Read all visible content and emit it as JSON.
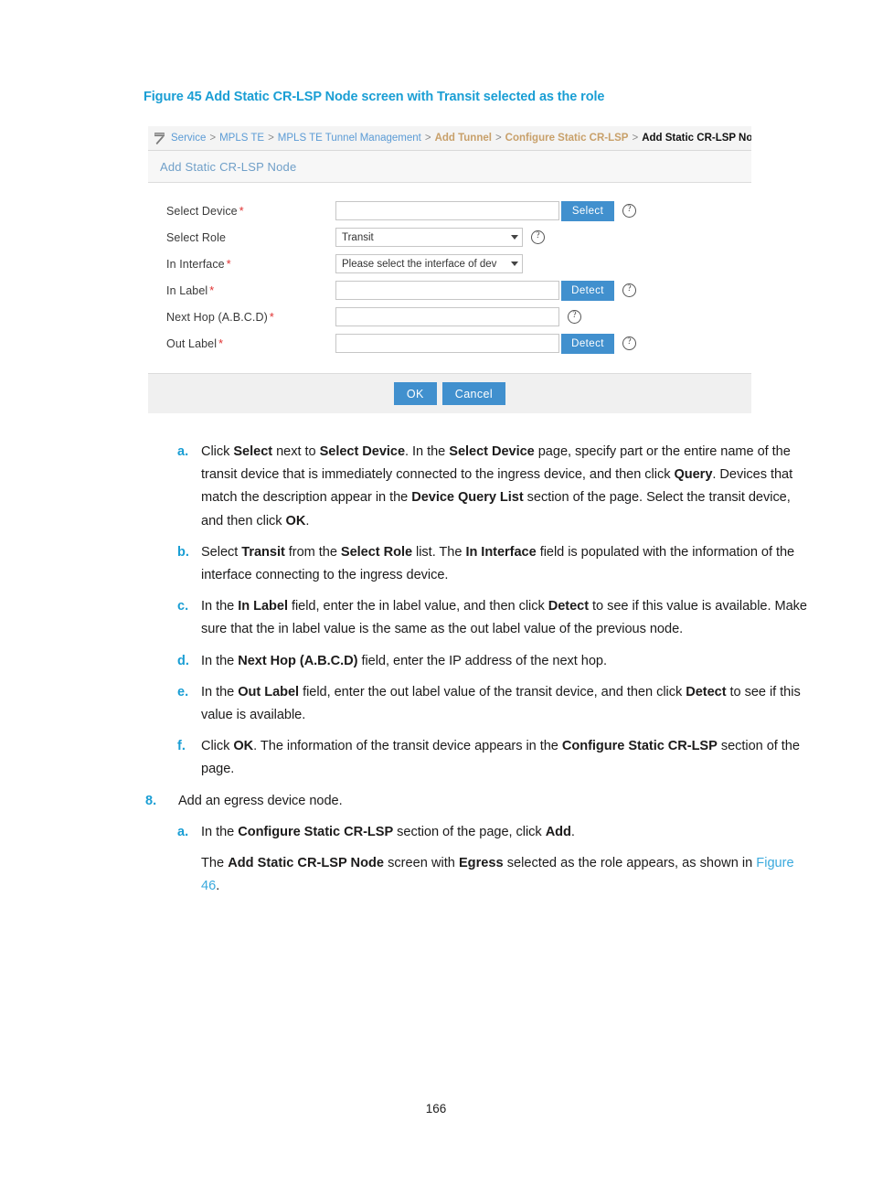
{
  "figure": {
    "caption": "Figure 45 Add Static CR-LSP Node screen with Transit selected as the role"
  },
  "screenshot": {
    "breadcrumb": {
      "icon": "tool-icon",
      "separator": ">",
      "items": [
        {
          "label": "Service",
          "style": "link"
        },
        {
          "label": "MPLS TE",
          "style": "link"
        },
        {
          "label": "MPLS TE Tunnel Management",
          "style": "link"
        },
        {
          "label": "Add Tunnel",
          "style": "tan"
        },
        {
          "label": "Configure Static CR-LSP",
          "style": "tan"
        },
        {
          "label": "Add Static CR-LSP Node",
          "style": "current"
        }
      ]
    },
    "panel_title": "Add Static CR-LSP Node",
    "fields": {
      "select_device": {
        "label": "Select Device",
        "required": "*",
        "value": "",
        "button": "Select",
        "help": "?"
      },
      "select_role": {
        "label": "Select Role",
        "required": "",
        "value": "Transit",
        "help": "?"
      },
      "in_interface": {
        "label": "In Interface",
        "required": "*",
        "value": "Please select the interface of dev"
      },
      "in_label": {
        "label": "In Label",
        "required": "*",
        "value": "",
        "button": "Detect",
        "help": "?"
      },
      "next_hop": {
        "label": "Next Hop (A.B.C.D)",
        "required": "*",
        "value": "",
        "help": "?"
      },
      "out_label": {
        "label": "Out Label",
        "required": "*",
        "value": "",
        "button": "Detect",
        "help": "?"
      }
    },
    "footer": {
      "ok": "OK",
      "cancel": "Cancel"
    }
  },
  "steps": {
    "a_marker": "a.",
    "b_marker": "b.",
    "c_marker": "c.",
    "d_marker": "d.",
    "e_marker": "e.",
    "f_marker": "f.",
    "step8_marker": "8.",
    "step8a_marker": "a."
  },
  "page": {
    "number": "166"
  }
}
